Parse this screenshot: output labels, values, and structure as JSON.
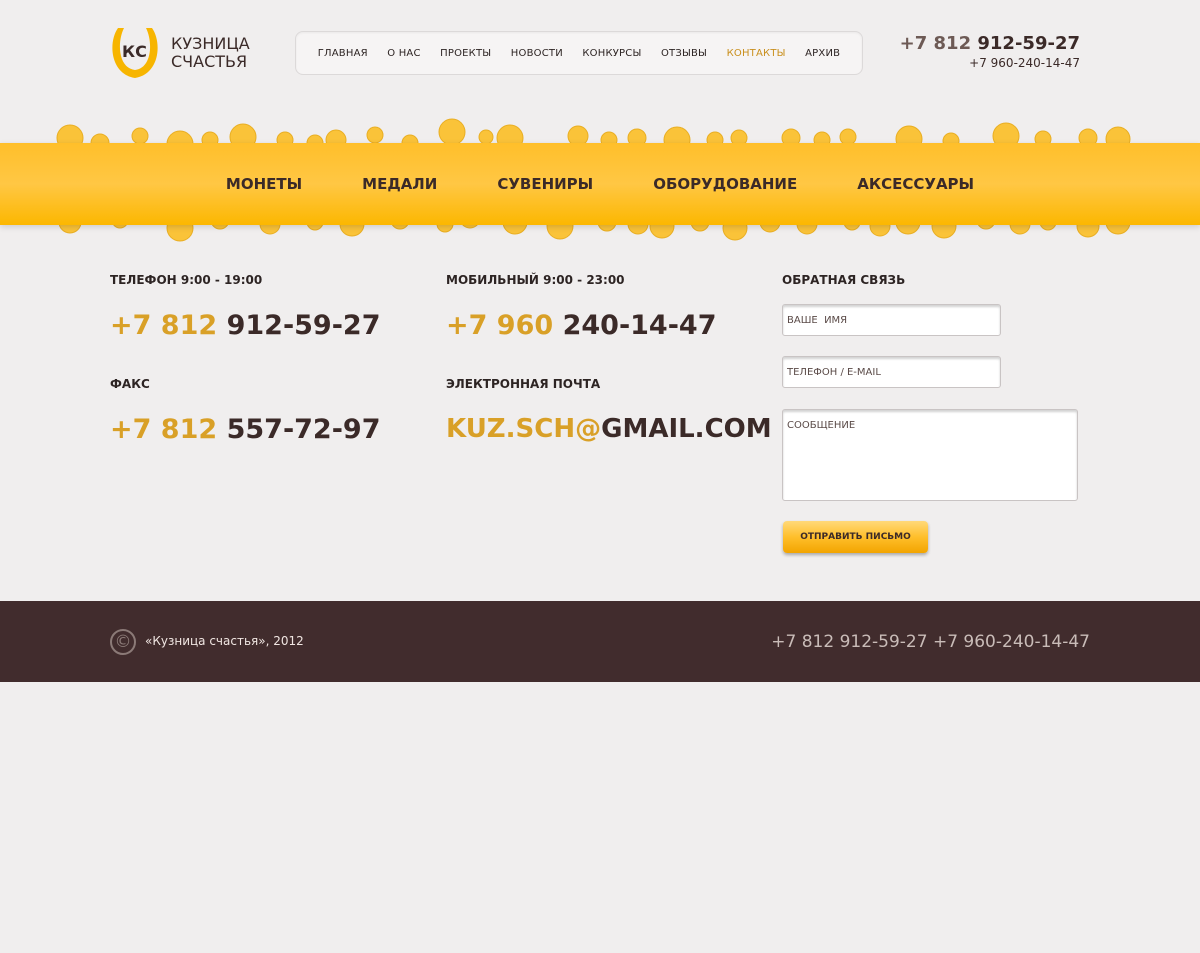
{
  "logo": {
    "mark": "КС",
    "line1": "КУЗНИЦА",
    "line2": "СЧАСТЬЯ"
  },
  "topnav": [
    {
      "label": "ГЛАВНАЯ",
      "active": false
    },
    {
      "label": "О НАС",
      "active": false
    },
    {
      "label": "ПРОЕКТЫ",
      "active": false
    },
    {
      "label": "НОВОСТИ",
      "active": false
    },
    {
      "label": "КОНКУРСЫ",
      "active": false
    },
    {
      "label": "ОТЗЫВЫ",
      "active": false
    },
    {
      "label": "КОНТАКТЫ",
      "active": true
    },
    {
      "label": "АРХИВ",
      "active": false
    }
  ],
  "header_phone": {
    "code": "+7 812",
    "number": "912-59-27",
    "secondary": "+7 960-240-14-47"
  },
  "categories": [
    "МОНЕТЫ",
    "МЕДАЛИ",
    "СУВЕНИРЫ",
    "ОБОРУДОВАНИЕ",
    "АКСЕССУАРЫ"
  ],
  "contacts": {
    "phone": {
      "label": "ТЕЛЕФОН 9:00 - 19:00",
      "code": "+7 812",
      "number": "912-59-27"
    },
    "mobile": {
      "label": "МОБИЛЬНЫЙ 9:00 - 23:00",
      "code": "+7 960",
      "number": "240-14-47"
    },
    "fax": {
      "label": "ФАКС",
      "code": "+7 812",
      "number": "557-72-97"
    },
    "email": {
      "label": "ЭЛЕКТРОННАЯ ПОЧТА",
      "user": "KUZ.SCH@",
      "domain": "GMAIL.COM"
    }
  },
  "feedback": {
    "title": "ОБРАТНАЯ СВЯЗЬ",
    "name_placeholder": "ВАШЕ  ИМЯ",
    "contact_placeholder": "ТЕЛЕФОН / E-MAIL",
    "message_placeholder": "СООБЩЕНИЕ",
    "submit_label": "ОТПРАВИТЬ ПИСЬМО"
  },
  "footer": {
    "copyright": "«Кузница счастья», 2012",
    "phones": "+7 812 912-59-27 +7 960-240-14-47"
  },
  "colors": {
    "accent": "#ffbf2a",
    "brand_dark": "#412c2d",
    "phone_code": "#d9a027"
  }
}
